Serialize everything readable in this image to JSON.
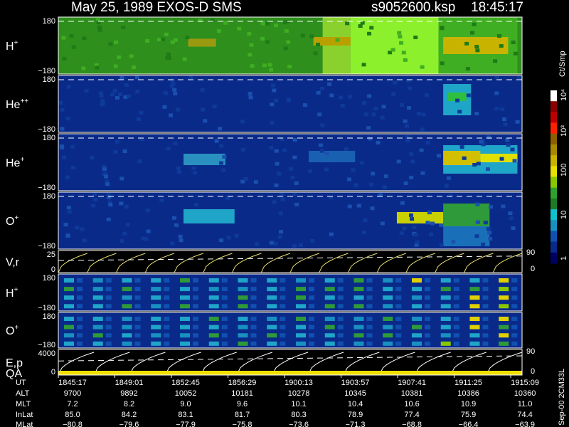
{
  "chart_data": {
    "type": "heatmap",
    "title": "May 25, 1989    EXOS-D SMS",
    "file_label": "s9052600.ksp",
    "time_label": "18:45:17",
    "panels": [
      {
        "label": "H",
        "sup": "+",
        "ymax": "180",
        "ymin": "−180",
        "kind": "heat",
        "base": "#2e8f1c",
        "patches": [
          {
            "t0": 0.57,
            "t1": 0.63,
            "color": "#8ad12e"
          },
          {
            "t0": 0.63,
            "t1": 0.82,
            "color": "#8df02c"
          },
          {
            "t0": 0.82,
            "t1": 0.99,
            "color": "#3fae22"
          },
          {
            "t0": 0.83,
            "t1": 0.97,
            "band": [
              0.35,
              0.65
            ],
            "color": "#c8b400"
          },
          {
            "t0": 0.55,
            "t1": 0.63,
            "band": [
              0.35,
              0.5
            ],
            "color": "#b8a000"
          },
          {
            "t0": 0.28,
            "t1": 0.34,
            "band": [
              0.38,
              0.52
            ],
            "color": "#9a9a10"
          }
        ]
      },
      {
        "label": "He",
        "sup": "++",
        "ymax": "180",
        "ymin": "−180",
        "kind": "heat",
        "base": "#0a2a8a",
        "patches": [
          {
            "t0": 0.83,
            "t1": 0.89,
            "band": [
              0.15,
              0.7
            ],
            "color": "#1fa5c8"
          },
          {
            "t0": 0.84,
            "t1": 0.88,
            "band": [
              0.3,
              0.45
            ],
            "color": "#2fbf40"
          }
        ]
      },
      {
        "label": "He",
        "sup": "+",
        "ymax": "180",
        "ymin": "−180",
        "kind": "heat",
        "base": "#0a2a8a",
        "patches": [
          {
            "t0": 0.27,
            "t1": 0.36,
            "band": [
              0.35,
              0.55
            ],
            "color": "#2a90c0"
          },
          {
            "t0": 0.54,
            "t1": 0.64,
            "band": [
              0.3,
              0.5
            ],
            "color": "#1a60b0"
          },
          {
            "t0": 0.83,
            "t1": 0.99,
            "band": [
              0.2,
              0.7
            ],
            "color": "#1fa5c8"
          },
          {
            "t0": 0.83,
            "t1": 0.91,
            "band": [
              0.3,
              0.55
            ],
            "color": "#d0c000"
          },
          {
            "t0": 0.91,
            "t1": 0.99,
            "band": [
              0.35,
              0.5
            ],
            "color": "#e0e000"
          }
        ]
      },
      {
        "label": "O",
        "sup": "+",
        "ymax": "180",
        "ymin": "−180",
        "kind": "heat",
        "base": "#0a2a8a",
        "patches": [
          {
            "t0": 0.27,
            "t1": 0.38,
            "band": [
              0.3,
              0.55
            ],
            "color": "#1fa5c8"
          },
          {
            "t0": 0.73,
            "t1": 0.83,
            "band": [
              0.35,
              0.55
            ],
            "color": "#c8d000"
          },
          {
            "t0": 0.83,
            "t1": 0.93,
            "band": [
              0.2,
              0.6
            ],
            "color": "#2e9a3a"
          },
          {
            "t0": 0.83,
            "t1": 0.93,
            "band": [
              0.6,
              0.95
            ],
            "color": "#1a70b8"
          }
        ]
      },
      {
        "label": "V,r",
        "sup": "",
        "ymax": "25",
        "ymin": "0",
        "right_max": "90",
        "right_min": "0",
        "kind": "line"
      },
      {
        "label": "H",
        "sup": "+",
        "ymax": "180",
        "ymin": "−180",
        "kind": "stripes",
        "base": "#0a2a8a"
      },
      {
        "label": "O",
        "sup": "+",
        "ymax": "180",
        "ymin": "−180",
        "kind": "stripes",
        "base": "#0a2a8a"
      },
      {
        "label": "E,p",
        "label2": "QA",
        "sup": "",
        "ymax": "4000",
        "ymin": "0",
        "right_max": "90",
        "right_min": "0",
        "kind": "energy"
      }
    ],
    "colorbar": {
      "unit": "Ct/Smp",
      "labels": [
        "10⁴",
        "10³",
        "100",
        "10",
        "1"
      ],
      "colors": [
        "#ffffff",
        "#8a0000",
        "#c00000",
        "#ff2000",
        "#8a6000",
        "#a88a00",
        "#c8b400",
        "#e8e000",
        "#88c800",
        "#2fa030",
        "#1f7a28",
        "#10c0d0",
        "#1890c0",
        "#1050b0",
        "#0a2a8a",
        "#000060"
      ]
    },
    "x_axis": {
      "rows": [
        {
          "name": "UT",
          "values": [
            "1845:17",
            "1849:01",
            "1852:45",
            "1856:29",
            "1900:13",
            "1903:57",
            "1907:41",
            "1911:25",
            "1915:09"
          ]
        },
        {
          "name": "ALT",
          "values": [
            "9700",
            "9892",
            "10052",
            "10181",
            "10278",
            "10345",
            "10381",
            "10386",
            "10360"
          ]
        },
        {
          "name": "MLT",
          "values": [
            "7.2",
            "8.2",
            "9.0",
            "9.6",
            "10.1",
            "10.4",
            "10.6",
            "10.9",
            "11.0"
          ]
        },
        {
          "name": "InLat",
          "values": [
            "85.0",
            "84.2",
            "83.1",
            "81.7",
            "80.3",
            "78.9",
            "77.4",
            "75.9",
            "74.4"
          ]
        },
        {
          "name": "MLat",
          "values": [
            "−80.8",
            "−79.6",
            "−77.9",
            "−75.8",
            "−73.6",
            "−71.3",
            "−68.8",
            "−66.4",
            "−63.9"
          ]
        }
      ]
    },
    "footer_note": "Sep-00 2CM33L"
  }
}
